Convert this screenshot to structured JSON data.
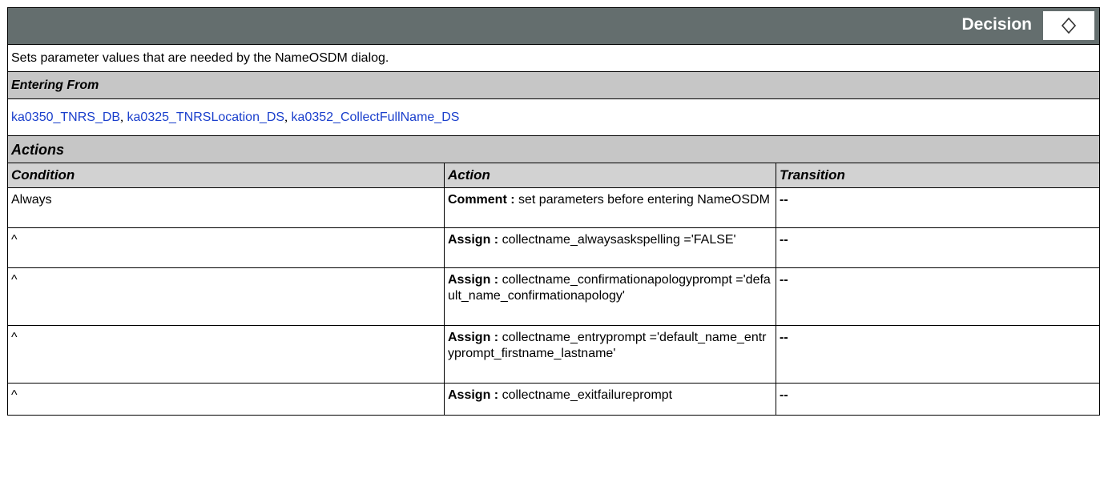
{
  "header": {
    "title": "Decision",
    "icon": "diamond-icon"
  },
  "description": "Sets parameter values that are needed by the NameOSDM dialog.",
  "entering_from": {
    "label": "Entering From",
    "links": [
      "ka0350_TNRS_DB",
      "ka0325_TNRSLocation_DS",
      "ka0352_CollectFullName_DS"
    ],
    "separator": ","
  },
  "actions": {
    "label": "Actions",
    "columns": {
      "condition": "Condition",
      "action": "Action",
      "transition": "Transition"
    },
    "rows": [
      {
        "condition": "Always",
        "kind": "Comment :",
        "text": " set parameters before entering NameOSDM",
        "transition": "--"
      },
      {
        "condition": "^",
        "kind": "Assign :",
        "text": " collectname_alwaysaskspelling ='FALSE'",
        "transition": "--"
      },
      {
        "condition": "^",
        "kind": "Assign :",
        "text": " collectname_confirmationapologyprompt ='default_name_confirmationapology'",
        "transition": "--"
      },
      {
        "condition": "^",
        "kind": "Assign :",
        "text": " collectname_entryprompt ='default_name_entryprompt_firstname_lastname'",
        "transition": "--"
      },
      {
        "condition": "^",
        "kind": "Assign :",
        "text": " collectname_exitfailureprompt",
        "transition": "--"
      }
    ]
  },
  "colors": {
    "header_bg": "#646e6e",
    "section_bg": "#c6c6c6",
    "link": "#1a3fcc"
  }
}
